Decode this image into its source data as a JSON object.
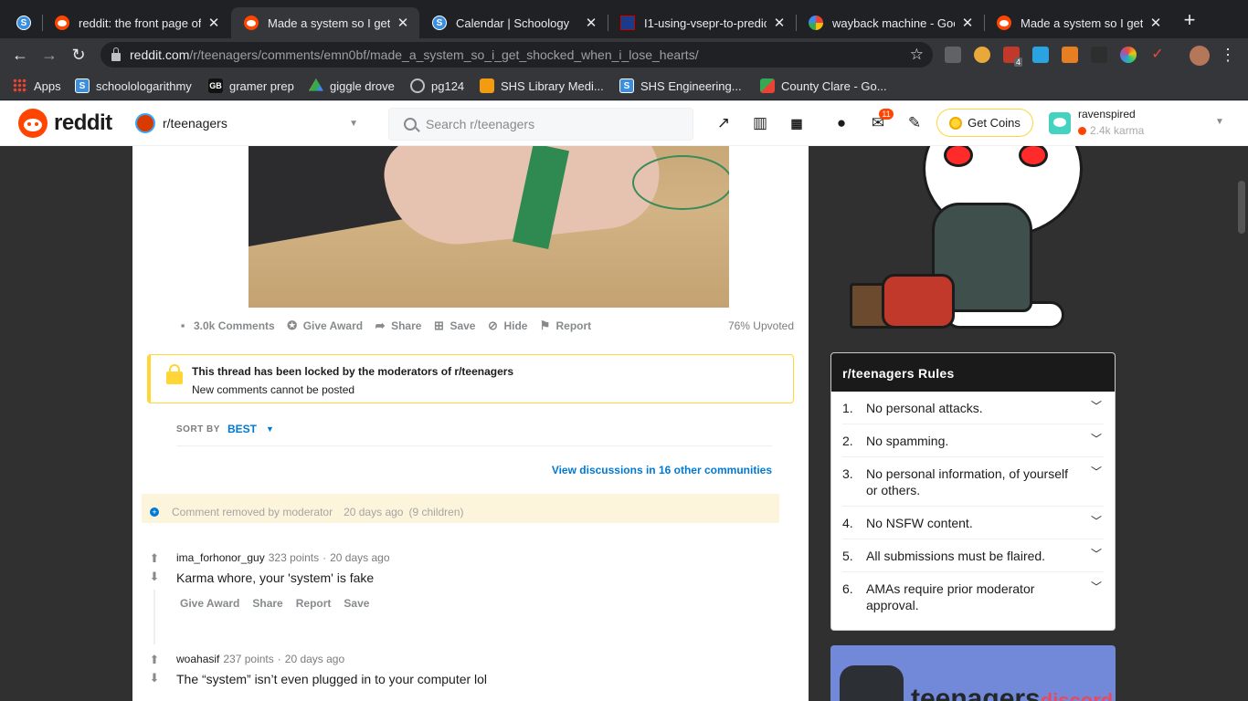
{
  "browser": {
    "tabs": [
      {
        "title": "",
        "icon": "schoology-icon",
        "active": false
      },
      {
        "title": "reddit: the front page of t",
        "icon": "reddit-icon",
        "active": false
      },
      {
        "title": "Made a system so I get s",
        "icon": "reddit-icon",
        "active": true
      },
      {
        "title": "Calendar | Schoology",
        "icon": "schoology-icon",
        "active": false
      },
      {
        "title": "I1-using-vsepr-to-predic",
        "icon": "university-shield-icon",
        "active": false
      },
      {
        "title": "wayback machine - Goog",
        "icon": "google-icon",
        "active": false
      },
      {
        "title": "Made a system so I get s",
        "icon": "reddit-icon",
        "active": false
      }
    ],
    "url_host": "reddit.com",
    "url_path": "/r/teenagers/comments/emn0bf/made_a_system_so_i_get_shocked_when_i_lose_hearts/",
    "extension_badge": "4",
    "bookmarks": [
      {
        "label": "Apps",
        "icon": "apps-grid-icon"
      },
      {
        "label": "schoolologarithmy",
        "icon": "schoology-icon"
      },
      {
        "label": "gramer prep",
        "icon": "gb-icon"
      },
      {
        "label": "giggle drove",
        "icon": "google-drive-icon"
      },
      {
        "label": "pg124",
        "icon": "globe-icon"
      },
      {
        "label": "SHS Library Medi...",
        "icon": "library-icon"
      },
      {
        "label": "SHS Engineering...",
        "icon": "schoology-icon"
      },
      {
        "label": "County Clare - Go...",
        "icon": "maps-icon"
      }
    ]
  },
  "reddit_header": {
    "logo_text": "reddit",
    "community": "r/teenagers",
    "search_placeholder": "Search r/teenagers",
    "mail_badge": "11",
    "coins_label": "Get Coins",
    "username": "ravenspired",
    "karma": "2.4k karma"
  },
  "post": {
    "actions": [
      {
        "label": "3.0k Comments",
        "icon": "comment-icon"
      },
      {
        "label": "Give Award",
        "icon": "award-icon"
      },
      {
        "label": "Share",
        "icon": "share-icon"
      },
      {
        "label": "Save",
        "icon": "save-icon"
      },
      {
        "label": "Hide",
        "icon": "hide-icon"
      },
      {
        "label": "Report",
        "icon": "report-flag-icon"
      }
    ],
    "upvoted": "76% Upvoted",
    "locked_title": "This thread has been locked by the moderators of r/teenagers",
    "locked_sub": "New comments cannot be posted",
    "sort_label": "SORT BY",
    "sort_value": "BEST",
    "other_discussions": "View discussions in 16 other communities"
  },
  "removed_comment": {
    "text": "Comment removed by moderator",
    "time": "20 days ago",
    "children": "(9 children)"
  },
  "comments": [
    {
      "author": "ima_forhonor_guy",
      "points": "323 points",
      "time": "20 days ago",
      "body": "Karma whore, your 'system' is fake",
      "actions": [
        "Give Award",
        "Share",
        "Report",
        "Save"
      ]
    },
    {
      "author": "woahasif",
      "points": "237 points",
      "time": "20 days ago",
      "body": "The “system” isn’t even plugged in to your computer lol"
    }
  ],
  "sidebar": {
    "rules_title": "r/teenagers Rules",
    "rules": [
      {
        "num": "1.",
        "text": "No personal attacks."
      },
      {
        "num": "2.",
        "text": "No spamming."
      },
      {
        "num": "3.",
        "text": "No personal information, of yourself or others."
      },
      {
        "num": "4.",
        "text": "No NSFW content."
      },
      {
        "num": "5.",
        "text": "All submissions must be flaired."
      },
      {
        "num": "6.",
        "text": "AMAs require prior moderator approval."
      }
    ],
    "discord_text": "teenagers",
    "discord_small": "discord"
  },
  "colors": {
    "reddit_orange": "#ff4500",
    "link_blue": "#0079d3",
    "lock_yellow": "#ffd635",
    "dark_bg": "#303030"
  }
}
